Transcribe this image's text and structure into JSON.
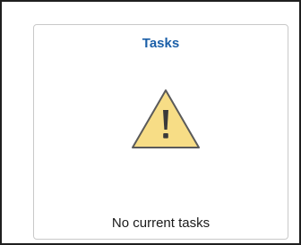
{
  "tile": {
    "title": "Tasks",
    "icon": "warning-icon",
    "message": "No current tasks"
  },
  "colors": {
    "title": "#1b5fa8",
    "warning_fill": "#f7dd86",
    "warning_stroke": "#5a5a5a",
    "border": "#c9c9c9"
  }
}
